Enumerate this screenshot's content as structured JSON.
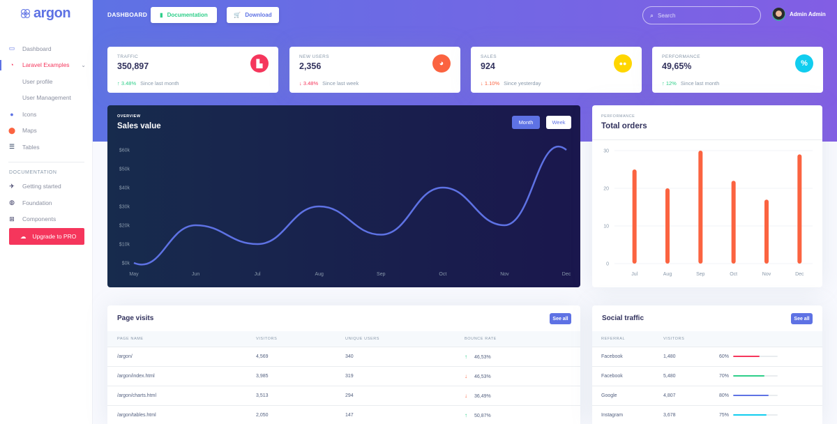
{
  "brand": {
    "name": "argon",
    "accent": "#5e72e4"
  },
  "sidebar": {
    "items": [
      {
        "label": "Dashboard",
        "icon": "tv-icon",
        "glyph": "▭",
        "color": "#5e72e4"
      },
      {
        "label": "Laravel Examples",
        "icon": "laravel-icon",
        "glyph": "◔",
        "color": "#f5365c",
        "active": true,
        "expanded": true
      },
      {
        "label": "User profile",
        "sub": true
      },
      {
        "label": "User Management",
        "sub": true
      },
      {
        "label": "Icons",
        "icon": "planet-icon",
        "glyph": "●",
        "color": "#5e72e4"
      },
      {
        "label": "Maps",
        "icon": "pin-icon",
        "glyph": "📍",
        "color": "#fb6340"
      },
      {
        "label": "Tables",
        "icon": "list-icon",
        "glyph": "☰",
        "color": "#172b4d"
      }
    ],
    "doc_heading": "DOCUMENTATION",
    "doc_items": [
      {
        "label": "Getting started",
        "icon": "spaceship-icon",
        "glyph": "✈"
      },
      {
        "label": "Foundation",
        "icon": "palette-icon",
        "glyph": "◍"
      },
      {
        "label": "Components",
        "icon": "ui-components-icon",
        "glyph": "⊞"
      }
    ],
    "upgrade_label": "Upgrade to PRO"
  },
  "topbar": {
    "title": "DASHBOARD",
    "documentation_label": "Documentation",
    "download_label": "Download",
    "search_placeholder": "Search",
    "user_name": "Admin Admin"
  },
  "stats": [
    {
      "label": "TRAFFIC",
      "value": "350,897",
      "change": "3.48%",
      "direction": "up",
      "since": "Since last month",
      "icon": "chart-bar-icon",
      "glyph": "▙",
      "color": "#f5365c"
    },
    {
      "label": "NEW USERS",
      "value": "2,356",
      "change": "3.48%",
      "direction": "down",
      "since": "Since last week",
      "icon": "chart-pie-icon",
      "glyph": "◕",
      "color": "#fb6340"
    },
    {
      "label": "SALES",
      "value": "924",
      "change": "1.10%",
      "direction": "down",
      "since": "Since yesterday",
      "icon": "users-icon",
      "glyph": "👥",
      "color": "#ffd600"
    },
    {
      "label": "PERFORMANCE",
      "value": "49,65%",
      "change": "12%",
      "direction": "up",
      "since": "Since last month",
      "icon": "percent-icon",
      "glyph": "%",
      "color": "#11cdef"
    }
  ],
  "sales_card": {
    "kicker": "OVERVIEW",
    "title": "Sales value",
    "month_label": "Month",
    "week_label": "Week"
  },
  "orders_card": {
    "kicker": "PERFORMANCE",
    "title": "Total orders"
  },
  "chart_data": [
    {
      "type": "line",
      "title": "Sales value",
      "categories": [
        "May",
        "Jun",
        "Jul",
        "Aug",
        "Sep",
        "Oct",
        "Nov",
        "Dec"
      ],
      "values": [
        0,
        20,
        10,
        30,
        15,
        40,
        20,
        60
      ],
      "yticks": [
        "$0k",
        "$10k",
        "$20k",
        "$30k",
        "$40k",
        "$50k",
        "$60k"
      ],
      "ylim": [
        0,
        60
      ],
      "yunit": "k$",
      "color": "#5e72e4",
      "grid": false
    },
    {
      "type": "bar",
      "title": "Total orders",
      "categories": [
        "Jul",
        "Aug",
        "Sep",
        "Oct",
        "Nov",
        "Dec"
      ],
      "values": [
        25,
        20,
        30,
        22,
        17,
        29
      ],
      "yticks": [
        "0",
        "10",
        "20",
        "30"
      ],
      "ylim": [
        0,
        30
      ],
      "color": "#fb6340",
      "grid": true
    }
  ],
  "page_visits": {
    "title": "Page visits",
    "see_all": "See all",
    "columns": [
      "PAGE NAME",
      "VISITORS",
      "UNIQUE USERS",
      "BOUNCE RATE"
    ],
    "rows": [
      {
        "page": "/argon/",
        "visitors": "4,569",
        "unique": "340",
        "bounce": "46,53%",
        "direction": "up"
      },
      {
        "page": "/argon/index.html",
        "visitors": "3,985",
        "unique": "319",
        "bounce": "46,53%",
        "direction": "down"
      },
      {
        "page": "/argon/charts.html",
        "visitors": "3,513",
        "unique": "294",
        "bounce": "36,49%",
        "direction": "down"
      },
      {
        "page": "/argon/tables.html",
        "visitors": "2,050",
        "unique": "147",
        "bounce": "50,87%",
        "direction": "up"
      }
    ]
  },
  "social_traffic": {
    "title": "Social traffic",
    "see_all": "See all",
    "columns": [
      "REFERRAL",
      "VISITORS",
      ""
    ],
    "rows": [
      {
        "referral": "Facebook",
        "visitors": "1,480",
        "percent_label": "60%",
        "percent": 60,
        "color": "#f5365c"
      },
      {
        "referral": "Facebook",
        "visitors": "5,480",
        "percent_label": "70%",
        "percent": 70,
        "color": "#2dce89"
      },
      {
        "referral": "Google",
        "visitors": "4,807",
        "percent_label": "80%",
        "percent": 80,
        "color": "#5e72e4"
      },
      {
        "referral": "Instagram",
        "visitors": "3,678",
        "percent_label": "75%",
        "percent": 75,
        "color": "#11cdef"
      }
    ]
  }
}
